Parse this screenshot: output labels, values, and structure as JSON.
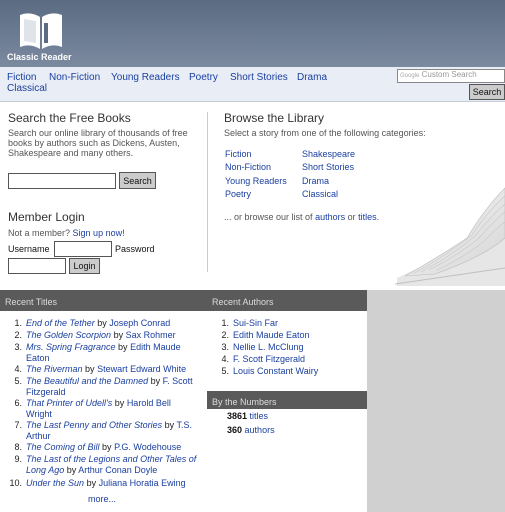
{
  "header": {
    "logo_text": "Classic Reader"
  },
  "nav": {
    "links": [
      "Fiction",
      "Non-Fiction",
      "Young Readers",
      "Poetry",
      "Short Stories",
      "Drama",
      "Classical"
    ],
    "search_placeholder": "Custom Search",
    "search_prefix": "Google",
    "search_button": "Search"
  },
  "search_books": {
    "title": "Search the Free Books",
    "description": "Search our online library of thousands of free books by authors such as Dickens, Austen, Shakespeare and many others.",
    "button": "Search"
  },
  "member_login": {
    "title": "Member Login",
    "prompt_text": "Not a member?",
    "signup_link": "Sign up now!",
    "username_label": "Username",
    "password_label": "Password",
    "login_button": "Login"
  },
  "browse": {
    "title": "Browse the Library",
    "description": "Select a story from one of the following categories:",
    "categories_left": [
      "Fiction",
      "Non-Fiction",
      "Young Readers",
      "Poetry"
    ],
    "categories_right": [
      "Shakespeare",
      "Short Stories",
      "Drama",
      "Classical"
    ],
    "or_text": "... or browse our list of",
    "authors_link": "authors",
    "or_word": "or",
    "titles_link": "titles",
    "end": "."
  },
  "recent_titles": {
    "heading": "Recent Titles",
    "by": "by",
    "items": [
      {
        "n": "1.",
        "title": "End of the Tether",
        "author": "Joseph Conrad"
      },
      {
        "n": "2.",
        "title": "The Golden Scorpion",
        "author": "Sax Rohmer"
      },
      {
        "n": "3.",
        "title": "Mrs. Spring Fragrance",
        "author": "Edith Maude Eaton"
      },
      {
        "n": "4.",
        "title": "The Riverman",
        "author": "Stewart Edward White"
      },
      {
        "n": "5.",
        "title": "The Beautiful and the Damned",
        "author": "F. Scott Fitzgerald"
      },
      {
        "n": "6.",
        "title": "That Printer of Udell's",
        "author": "Harold Bell Wright"
      },
      {
        "n": "7.",
        "title": "The Last Penny and Other Stories",
        "author": "T.S. Arthur"
      },
      {
        "n": "8.",
        "title": "The Coming of Bill",
        "author": "P.G. Wodehouse"
      },
      {
        "n": "9.",
        "title": "The Last of the Legions and Other Tales of Long Ago",
        "author": "Arthur Conan Doyle"
      },
      {
        "n": "10.",
        "title": "Under the Sun",
        "author": "Juliana Horatia Ewing"
      }
    ],
    "more": "more..."
  },
  "recent_authors": {
    "heading": "Recent Authors",
    "items": [
      {
        "n": "1.",
        "name": "Sui-Sin Far"
      },
      {
        "n": "2.",
        "name": "Edith Maude Eaton"
      },
      {
        "n": "3.",
        "name": "Nellie L. McClung"
      },
      {
        "n": "4.",
        "name": "F. Scott Fitzgerald"
      },
      {
        "n": "5.",
        "name": "Louis Constant Wairy"
      }
    ]
  },
  "by_numbers": {
    "heading": "By the Numbers",
    "titles_count": "3861",
    "titles_label": "titles",
    "authors_count": "360",
    "authors_label": "authors"
  },
  "colors": {
    "link": "#1a3fa0",
    "header_bg": "#5a6b82",
    "nav_bg": "#e9edf5",
    "panel_bg": "#5a5a5a"
  }
}
